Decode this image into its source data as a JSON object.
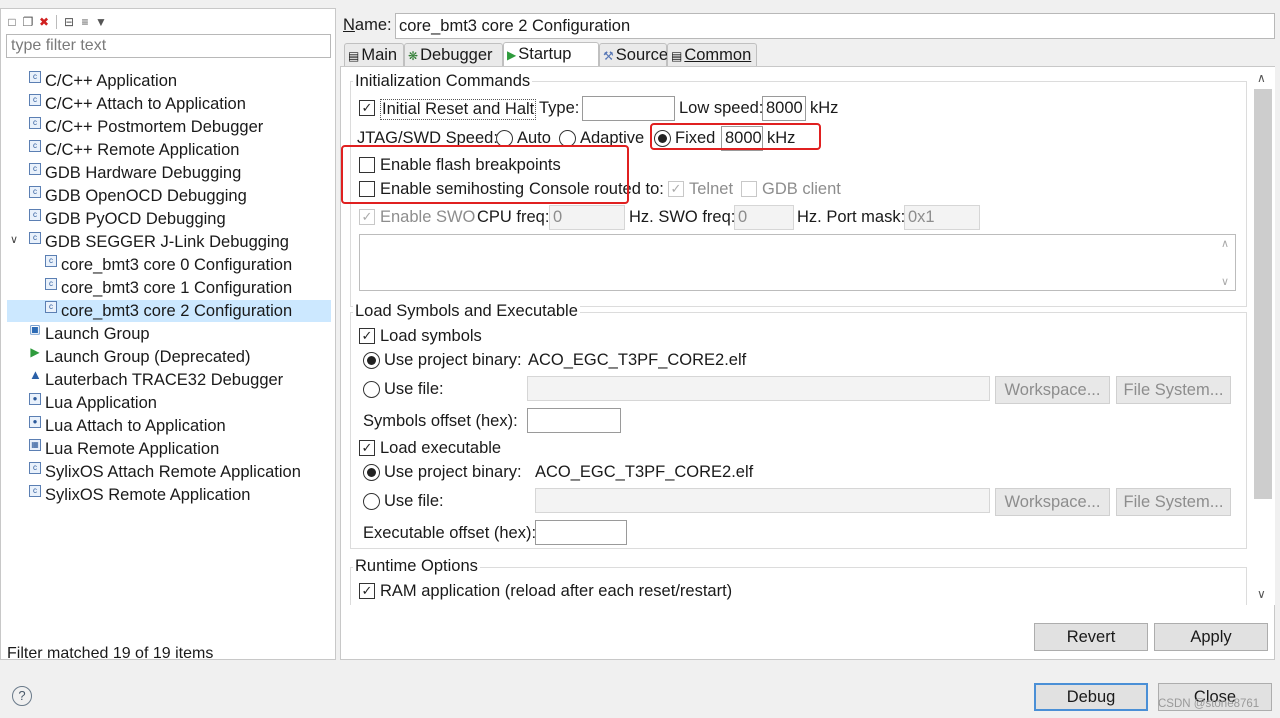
{
  "left_panel": {
    "toolbar": {
      "icons": [
        "new-config-icon",
        "duplicate-icon",
        "delete-icon",
        "collapse-all-icon",
        "filter-icon",
        "dropdown-icon"
      ]
    },
    "filter_placeholder": "type filter text",
    "tree": [
      "C/C++ Application",
      "C/C++ Attach to Application",
      "C/C++ Postmortem Debugger",
      "C/C++ Remote Application",
      "GDB Hardware Debugging",
      "GDB OpenOCD Debugging",
      "GDB PyOCD Debugging",
      "GDB SEGGER J-Link Debugging",
      "core_bmt3 core 0 Configuration",
      "core_bmt3 core 1 Configuration",
      "core_bmt3 core 2 Configuration",
      "Launch Group",
      "Launch Group (Deprecated)",
      "Lauterbach TRACE32 Debugger",
      "Lua Application",
      "Lua Attach to Application",
      "Lua Remote Application",
      "SylixOS Attach Remote Application",
      "SylixOS Remote Application"
    ],
    "status": "Filter matched 19 of 19 items"
  },
  "name": {
    "label_u": "N",
    "label_rest": "ame:",
    "value": "core_bmt3 core 2 Configuration"
  },
  "tabs": [
    "Main",
    "Debugger",
    "Startup",
    "Source",
    "Common"
  ],
  "active_tab": "Startup",
  "init": {
    "group": "Initialization Commands",
    "initial_reset": "Initial Reset and Halt",
    "type_label": "Type:",
    "type_value": "",
    "low_speed_label": "Low speed:",
    "low_speed_value": "8000",
    "khz": "kHz",
    "jtag_label": "JTAG/SWD Speed:",
    "auto": "Auto",
    "adaptive": "Adaptive",
    "fixed": "Fixed",
    "fixed_value": "8000",
    "khz2": "kHz",
    "flash_bp": "Enable flash breakpoints",
    "semihosting": "Enable semihosting",
    "console_routed": "Console routed to:",
    "telnet": "Telnet",
    "gdb_client": "GDB client",
    "enable_swo": "Enable SWO",
    "cpu_freq_label": "CPU freq:",
    "cpu_freq_value": "0",
    "hz_swo_label": "Hz. SWO freq:",
    "swo_freq_value": "0",
    "port_mask_label": "Hz. Port mask:",
    "port_mask_value": "0x1"
  },
  "load": {
    "group": "Load Symbols and Executable",
    "load_symbols": "Load symbols",
    "use_project_binary": "Use project binary:",
    "sym_binary": "ACO_EGC_T3PF_CORE2.elf",
    "use_file": "Use file:",
    "workspace": "Workspace...",
    "file_system": "File System...",
    "symbols_offset": "Symbols offset (hex):",
    "load_executable": "Load executable",
    "exe_binary": "ACO_EGC_T3PF_CORE2.elf",
    "executable_offset": "Executable offset (hex):"
  },
  "runtime": {
    "group": "Runtime Options",
    "ram_app": "RAM application (reload after each reset/restart)"
  },
  "buttons": {
    "revert": "Revert",
    "apply": "Apply",
    "debug": "Debug",
    "close": "Close"
  },
  "watermark": "CSDN @stone8761"
}
